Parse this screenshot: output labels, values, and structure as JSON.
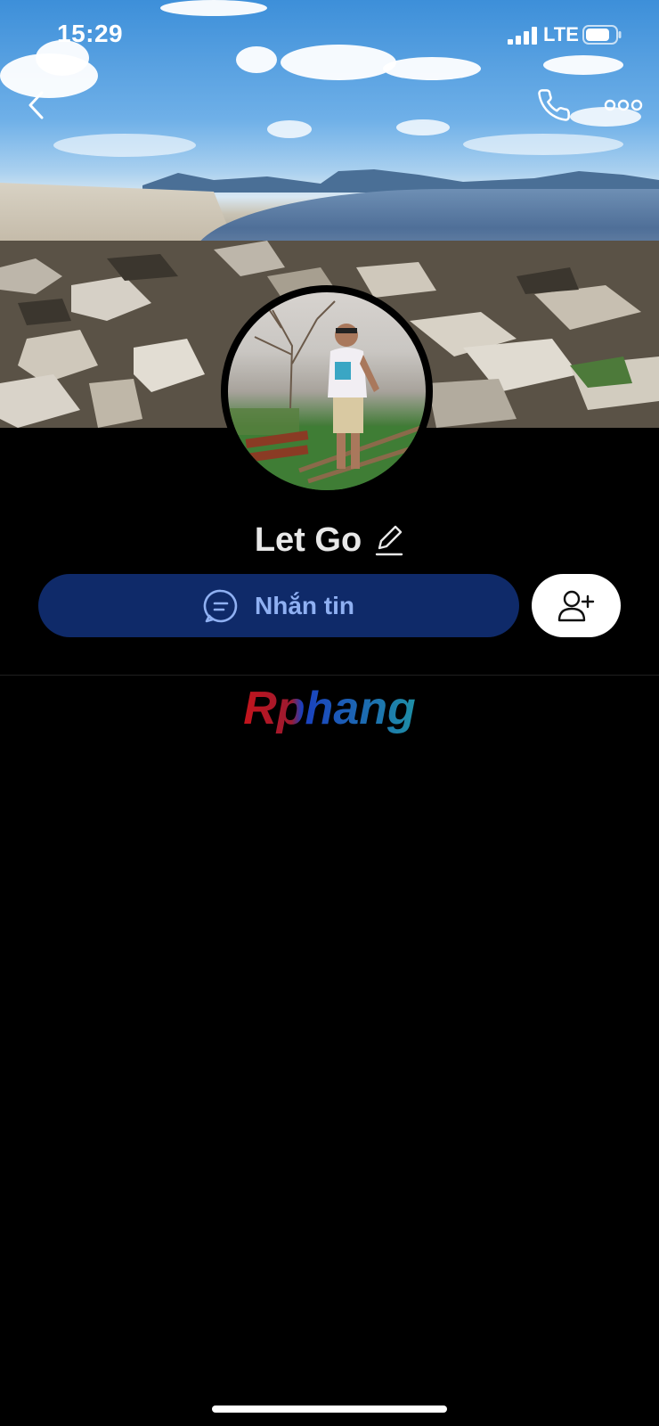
{
  "status_bar": {
    "time": "15:29",
    "network": "LTE",
    "icons": [
      "signal-icon",
      "battery-icon"
    ]
  },
  "header": {
    "back_icon": "chevron-left-icon",
    "call_icon": "phone-icon",
    "more_icon": "more-horizontal-icon"
  },
  "profile": {
    "name": "Let Go",
    "edit_icon": "pencil-icon"
  },
  "actions": {
    "message_label": "Nhắn tin",
    "message_icon": "chat-bubble-icon",
    "add_friend_icon": "add-user-icon"
  },
  "watermark": {
    "text": "Rphang"
  },
  "colors": {
    "background": "#000000",
    "message_button": "#0f2a69",
    "message_text": "#8fb0f2",
    "add_button": "#ffffff"
  }
}
